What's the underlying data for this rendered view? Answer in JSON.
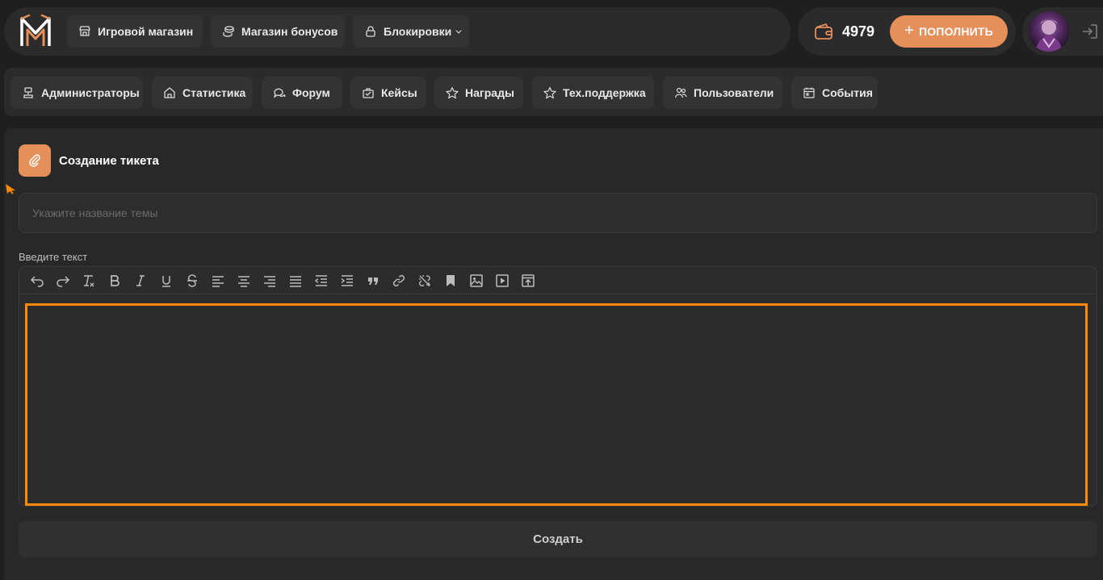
{
  "header": {
    "nav": [
      {
        "label": "Игровой магазин",
        "icon": "store-icon"
      },
      {
        "label": "Магазин бонусов",
        "icon": "coins-icon"
      },
      {
        "label": "Блокировки",
        "icon": "lock-icon",
        "dropdown": true
      }
    ],
    "balance": "4979",
    "topup_label": "ПОПОЛНИТЬ"
  },
  "menu": {
    "items": [
      {
        "label": "Администраторы",
        "icon": "admin-icon"
      },
      {
        "label": "Статистика",
        "icon": "home-icon"
      },
      {
        "label": "Форум",
        "icon": "chat-icon"
      },
      {
        "label": "Кейсы",
        "icon": "case-icon"
      },
      {
        "label": "Награды",
        "icon": "star-icon"
      },
      {
        "label": "Тех.поддержка",
        "icon": "star-icon"
      },
      {
        "label": "Пользователи",
        "icon": "users-icon"
      },
      {
        "label": "События",
        "icon": "calendar-icon"
      }
    ]
  },
  "ticket": {
    "title": "Создание тикета",
    "topic_placeholder": "Укажите название темы",
    "topic_value": "",
    "text_label": "Введите текст",
    "editor_content": "",
    "submit_label": "Создать"
  },
  "colors": {
    "accent": "#e58f5a",
    "focus": "#ff8a00",
    "background": "#1f1f1f",
    "panel": "#2b2b2b"
  }
}
